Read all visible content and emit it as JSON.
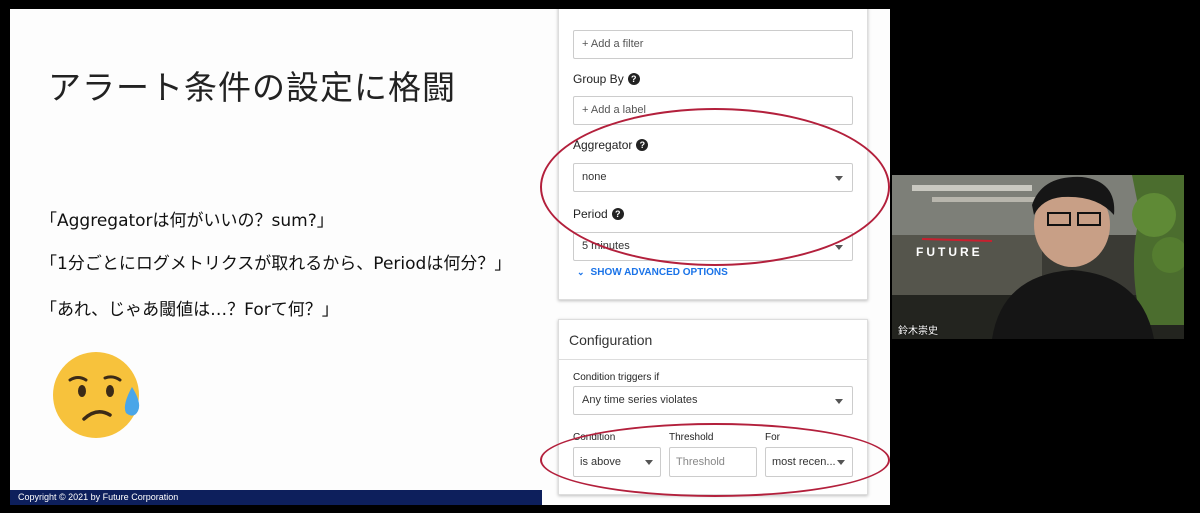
{
  "slide": {
    "title": "アラート条件の設定に格闘",
    "bullets": [
      "「Aggregatorは何がいいの？sum?」",
      "「1分ごとにログメトリクスが取れるから、Periodは何分？」",
      "「あれ、じゃあ閾値は…？Forて何？」"
    ],
    "emoji_icon": "sad-sweat-face-emoji",
    "footer": "Copyright © 2021 by Future Corporation"
  },
  "condition_form": {
    "filter_placeholder": "+ Add a filter",
    "group_by_label": "Group By",
    "group_by_placeholder": "+ Add a label",
    "aggregator_label": "Aggregator",
    "aggregator_value": "none",
    "period_label": "Period",
    "period_value": "5 minutes",
    "help_glyph": "?",
    "advanced_label": "SHOW ADVANCED OPTIONS"
  },
  "configuration": {
    "title": "Configuration",
    "triggers_label": "Condition triggers if",
    "triggers_value": "Any time series violates",
    "condition_label": "Condition",
    "condition_value": "is above",
    "threshold_label": "Threshold",
    "threshold_placeholder": "Threshold",
    "for_label": "For",
    "for_value": "most recen..."
  },
  "video": {
    "participant_name": "鈴木崇史",
    "background_logo": "FUTURE"
  },
  "colors": {
    "highlight_ellipse": "#b3203c",
    "link_blue": "#1a73e8",
    "footer_bar": "#0d1f5c"
  }
}
